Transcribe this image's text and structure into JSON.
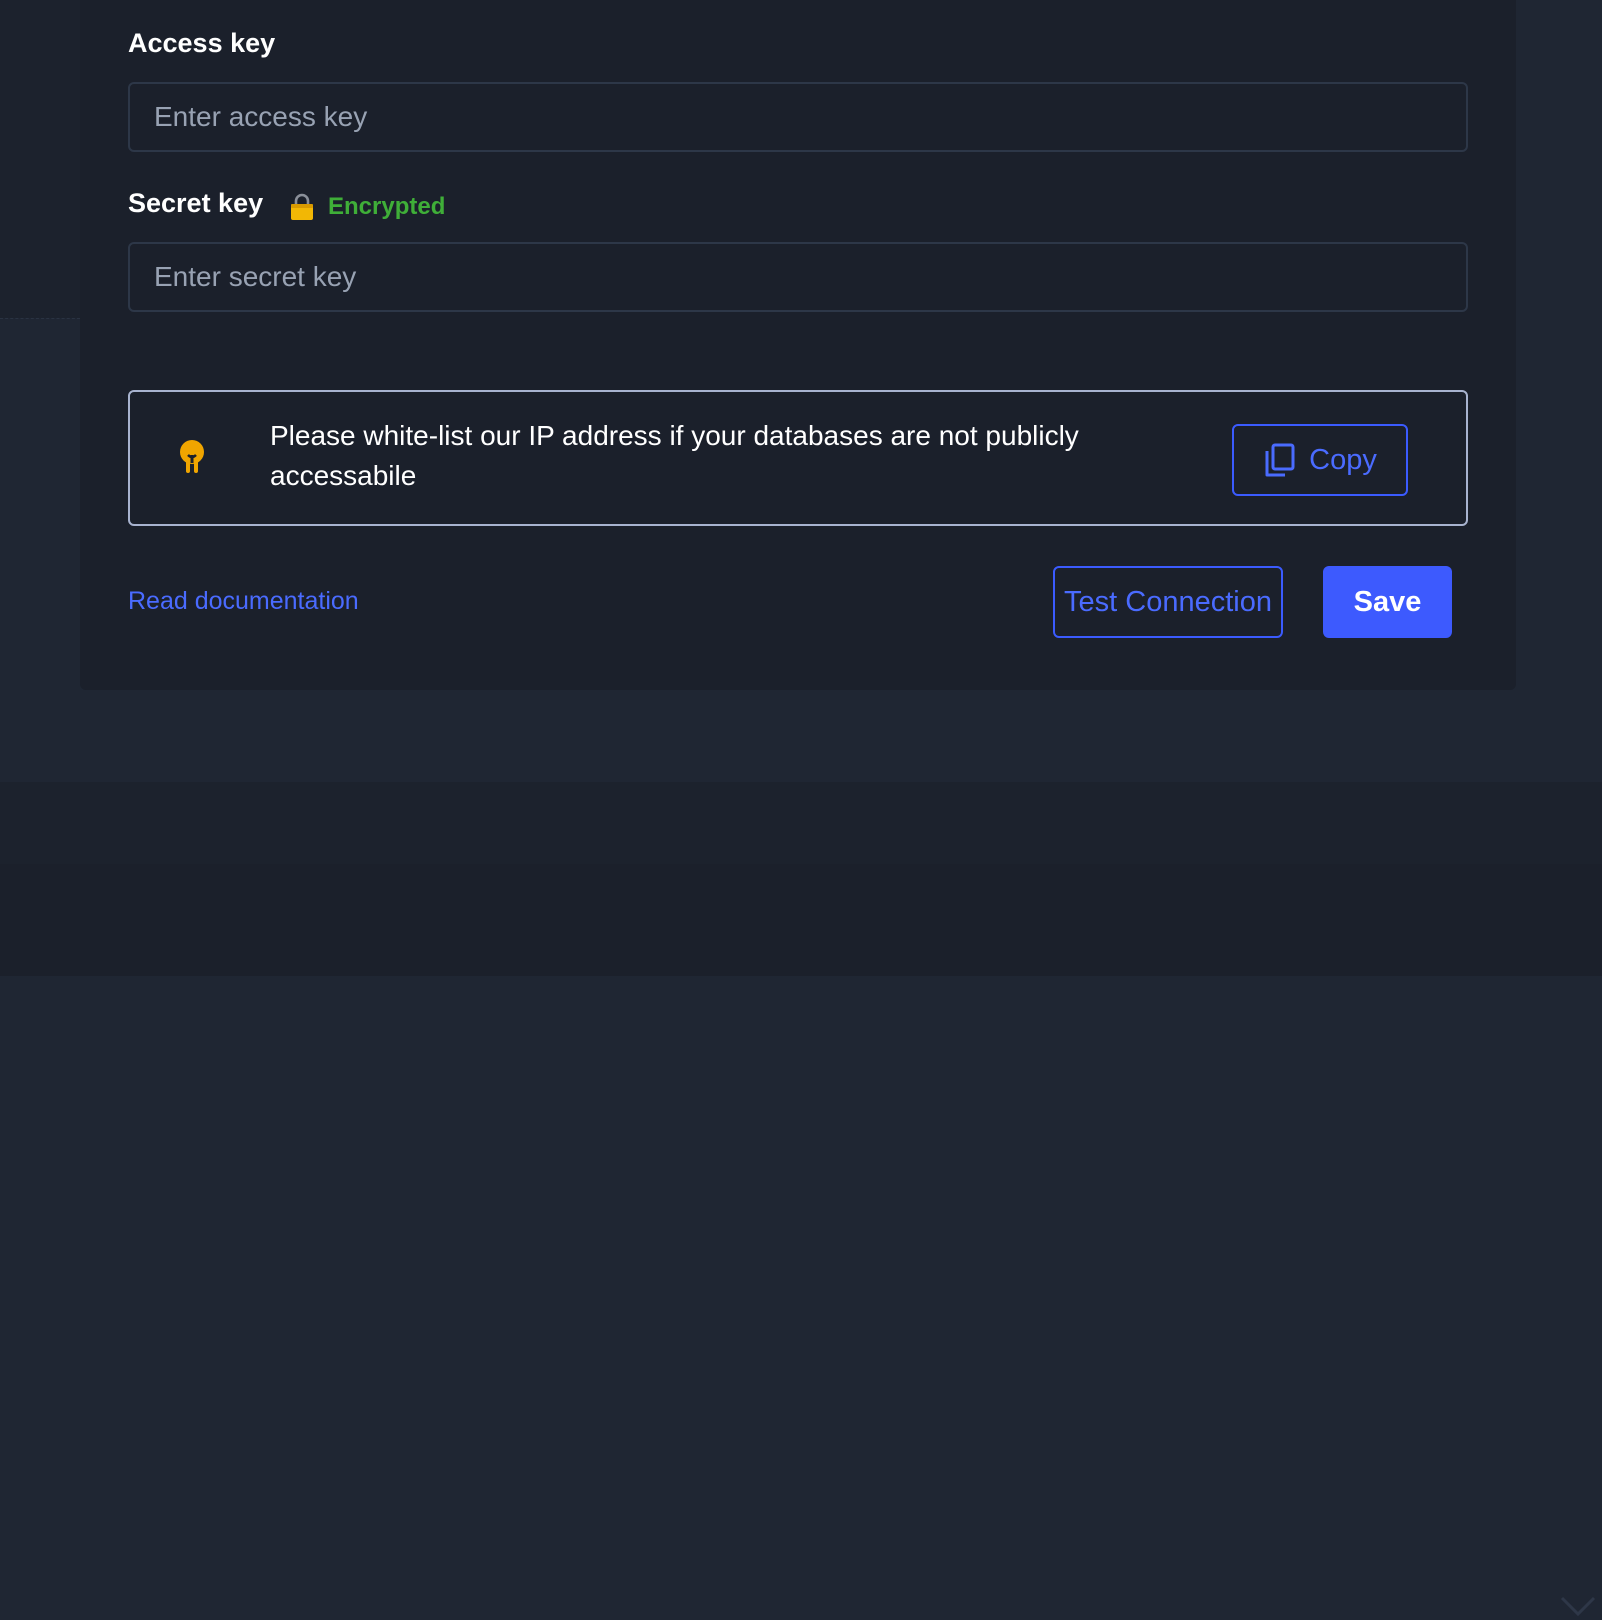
{
  "form": {
    "access_key": {
      "label": "Access key",
      "value": "",
      "placeholder": "Enter access key"
    },
    "secret_key": {
      "label": "Secret key",
      "badge": "Encrypted",
      "badge_icon": "lock-icon",
      "value": "",
      "placeholder": "Enter secret key"
    }
  },
  "notice": {
    "icon": "lightbulb-icon",
    "text": "Please white-list our IP address if your databases are not publicly accessabile",
    "copy_label": "Copy",
    "copy_icon": "copy-icon"
  },
  "footer": {
    "doc_link": "Read documentation",
    "test_label": "Test Connection",
    "save_label": "Save"
  },
  "colors": {
    "accent": "#3d5afe",
    "success": "#3fae38",
    "warning": "#f0a500",
    "panel_bg": "#1b202b",
    "page_bg": "#1f2633"
  },
  "icons": {
    "collapse": "chevron-down-icon"
  }
}
